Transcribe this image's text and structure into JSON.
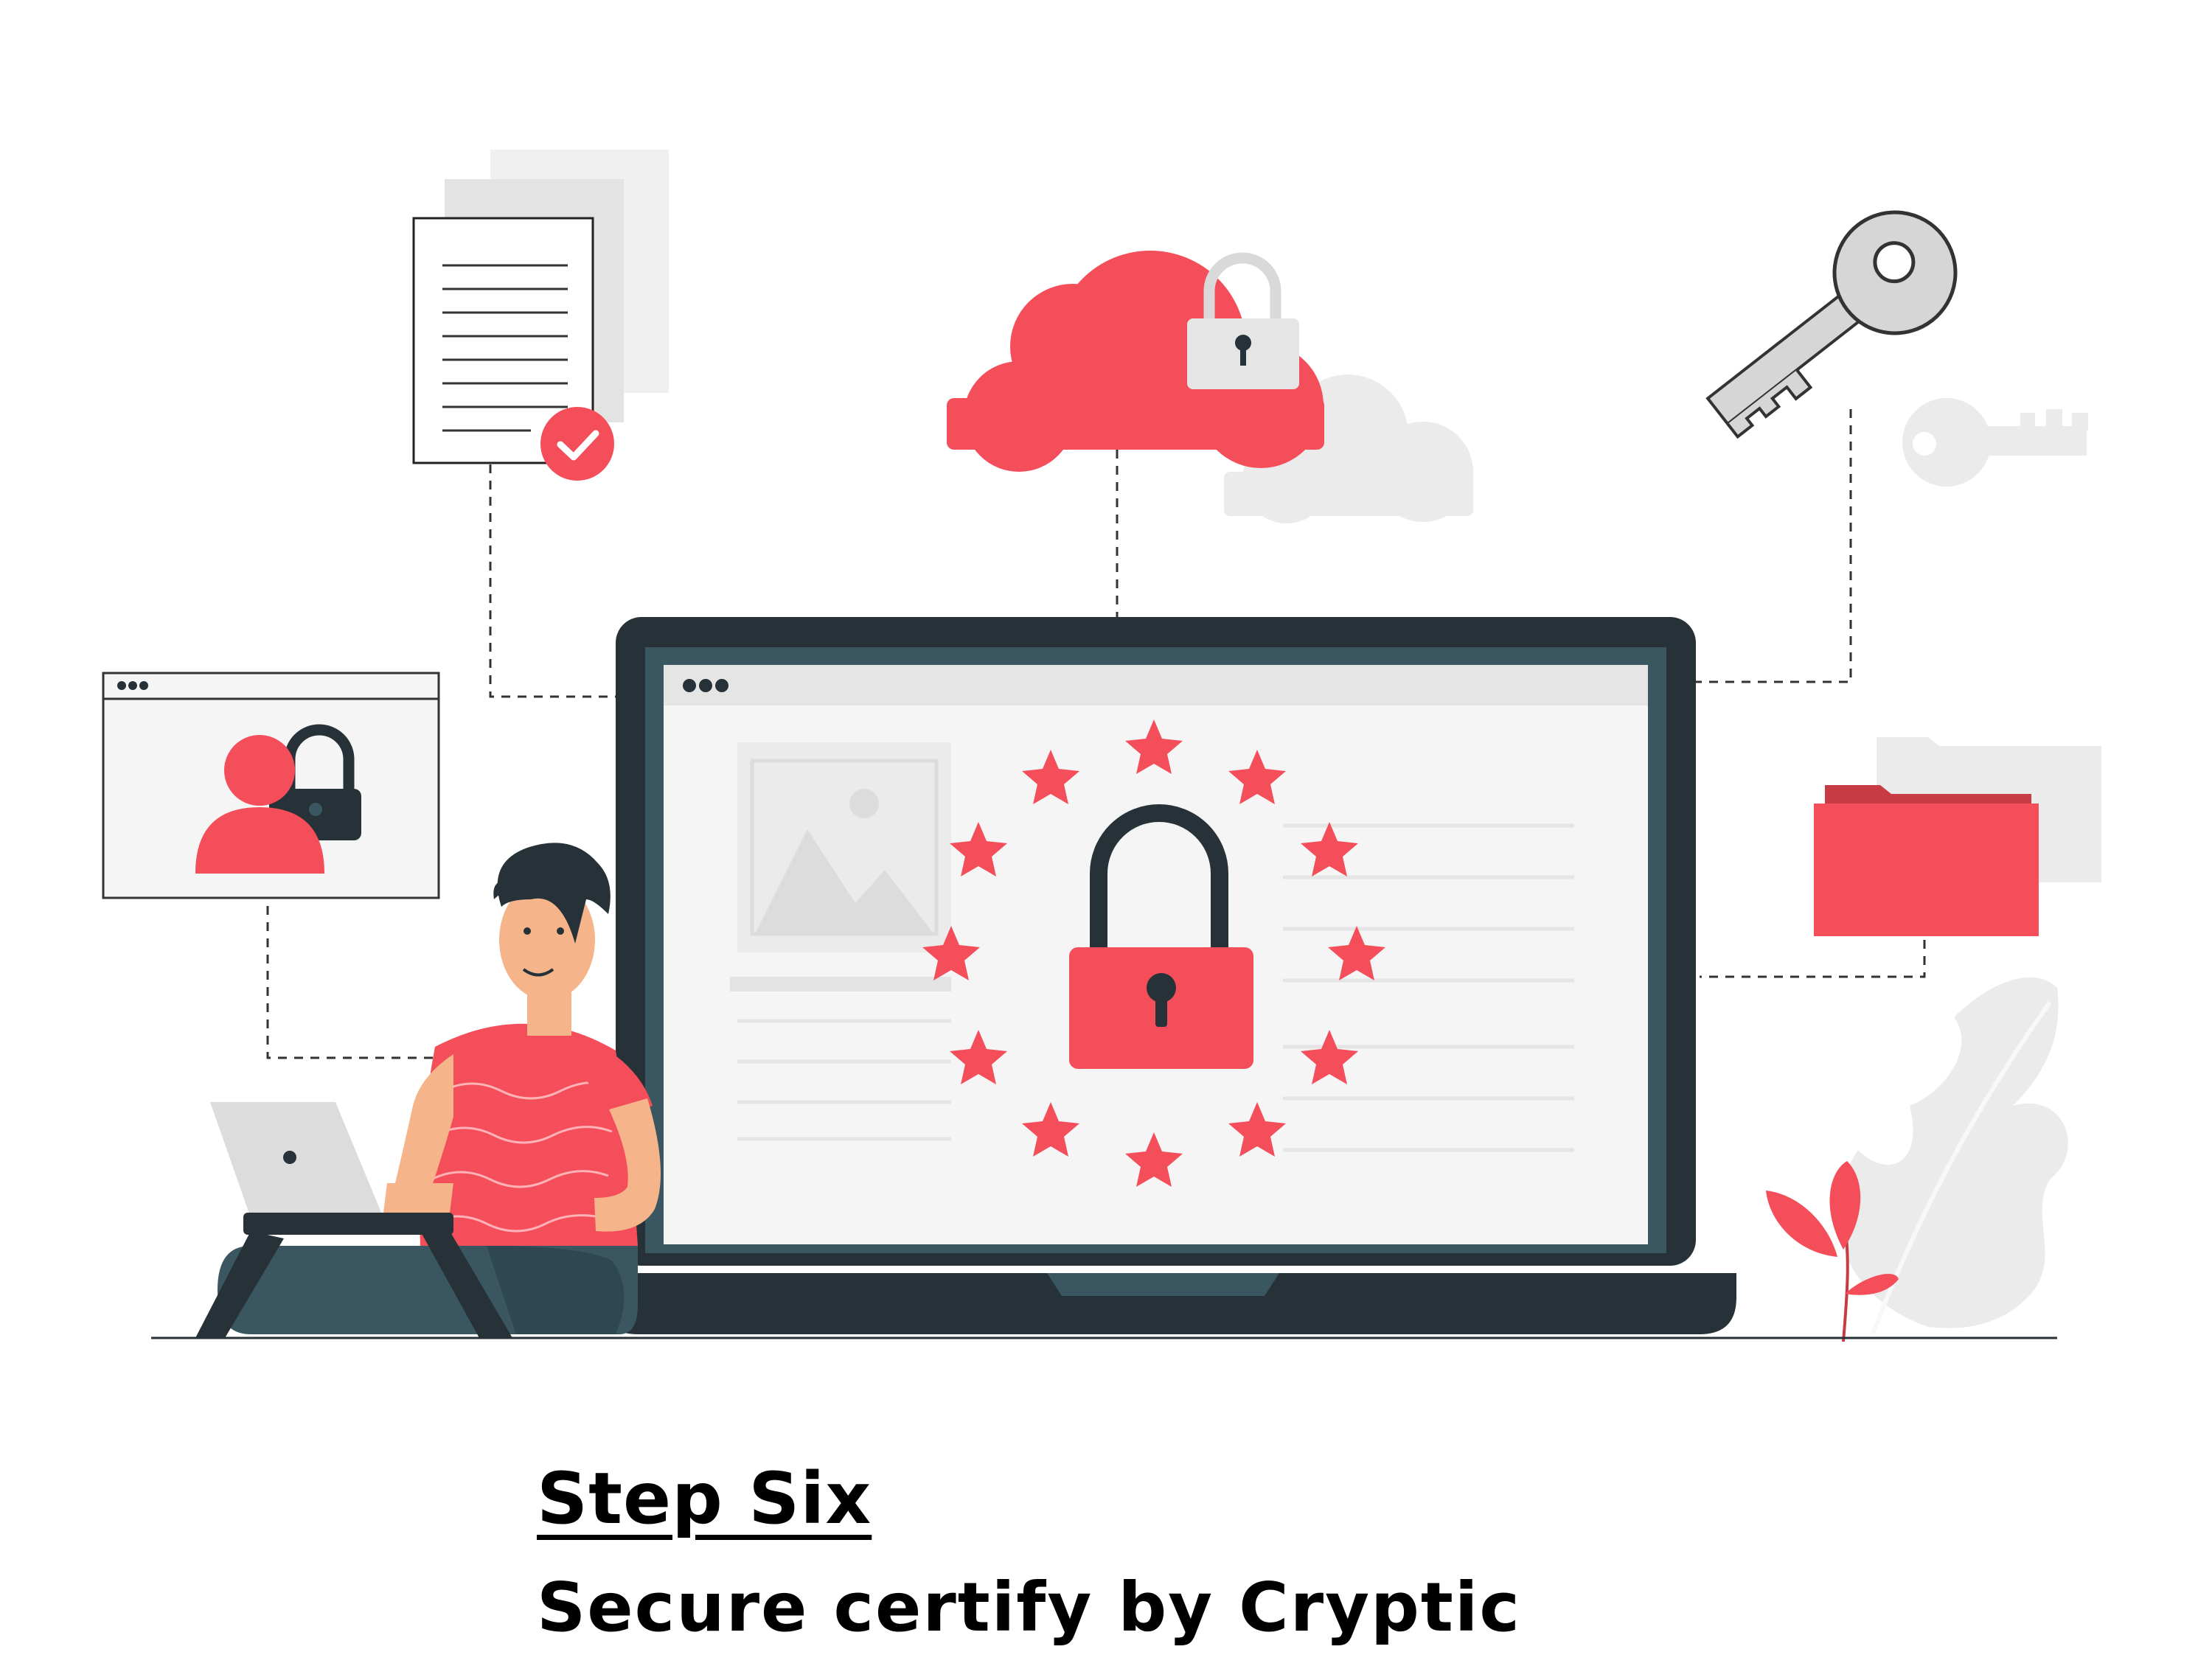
{
  "caption": {
    "title": "Step Six",
    "subtitle": "Secure certify by Cryptic"
  },
  "illustration": {
    "elements": [
      "document-with-check-icon",
      "cloud-with-padlock-icon",
      "key-icon",
      "user-padlock-window-icon",
      "laptop-with-padlock-and-stars",
      "person-using-laptop",
      "folder-icon",
      "plant-decoration"
    ]
  },
  "colors": {
    "accent": "#F44E5A",
    "dark": "#1F2E33",
    "dark_secondary": "#3A5660",
    "light_gray": "#EBEBEB",
    "mid_gray": "#D9D9D9",
    "screen": "#F5F5F5",
    "skin": "#F5B48A"
  }
}
